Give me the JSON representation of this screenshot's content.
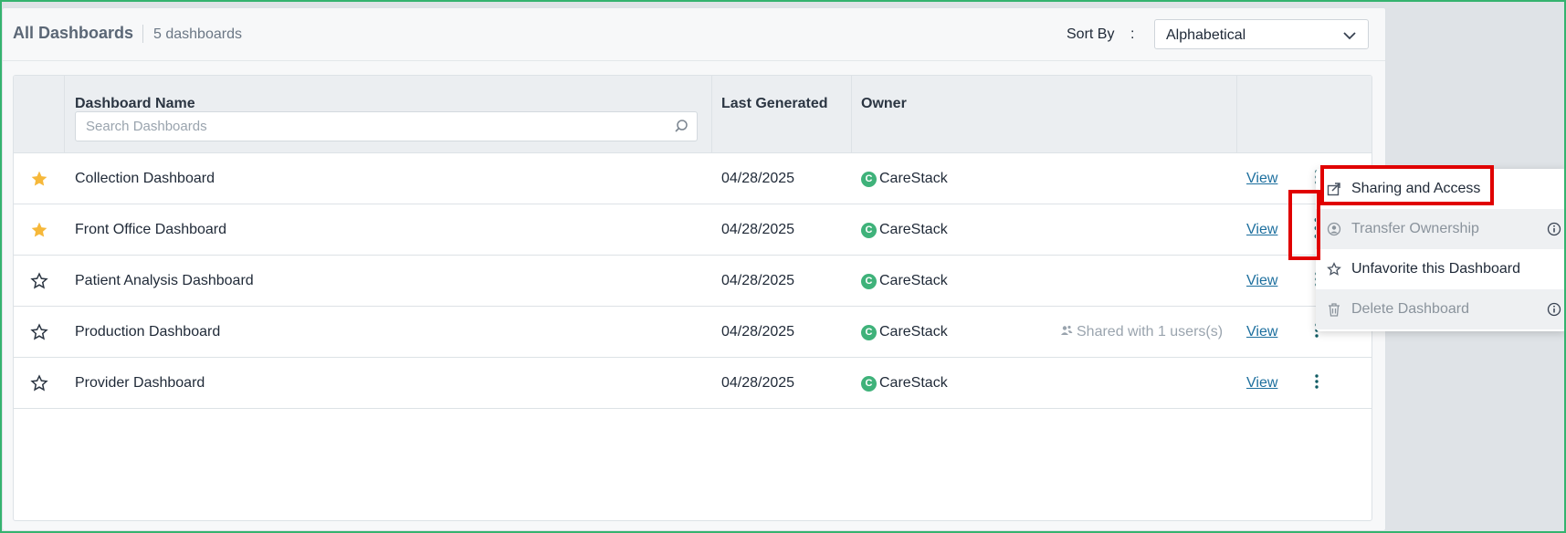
{
  "header": {
    "title": "All Dashboards",
    "count": "5 dashboards",
    "sort_label": "Sort By",
    "sort_colon": ":",
    "sort_value": "Alphabetical"
  },
  "table": {
    "columns": {
      "name": "Dashboard Name",
      "last_generated": "Last Generated",
      "owner": "Owner"
    },
    "search_placeholder": "Search Dashboards",
    "rows": [
      {
        "favorite": true,
        "name": "Collection Dashboard",
        "last_generated": "04/28/2025",
        "owner_initial": "C",
        "owner": "CareStack",
        "shared": "",
        "action": "View"
      },
      {
        "favorite": true,
        "name": "Front Office Dashboard",
        "last_generated": "04/28/2025",
        "owner_initial": "C",
        "owner": "CareStack",
        "shared": "",
        "action": "View"
      },
      {
        "favorite": false,
        "name": "Patient Analysis Dashboard",
        "last_generated": "04/28/2025",
        "owner_initial": "C",
        "owner": "CareStack",
        "shared": "",
        "action": "View"
      },
      {
        "favorite": false,
        "name": "Production Dashboard",
        "last_generated": "04/28/2025",
        "owner_initial": "C",
        "owner": "CareStack",
        "shared": "Shared with 1 users(s)",
        "action": "View"
      },
      {
        "favorite": false,
        "name": "Provider Dashboard",
        "last_generated": "04/28/2025",
        "owner_initial": "C",
        "owner": "CareStack",
        "shared": "",
        "action": "View"
      }
    ]
  },
  "menu": {
    "items": [
      {
        "label": "Sharing and Access",
        "icon": "share-icon",
        "disabled": false
      },
      {
        "label": "Transfer Ownership",
        "icon": "user-circle-icon",
        "disabled": true
      },
      {
        "label": "Unfavorite this Dashboard",
        "icon": "star-outline-icon",
        "disabled": false
      },
      {
        "label": "Delete Dashboard",
        "icon": "trash-icon",
        "disabled": true
      }
    ]
  },
  "colors": {
    "star_filled": "#f6b83a",
    "owner_badge": "#3fb27a",
    "link": "#1d6f9e",
    "highlight": "#e00000",
    "frame": "#35b36f"
  }
}
